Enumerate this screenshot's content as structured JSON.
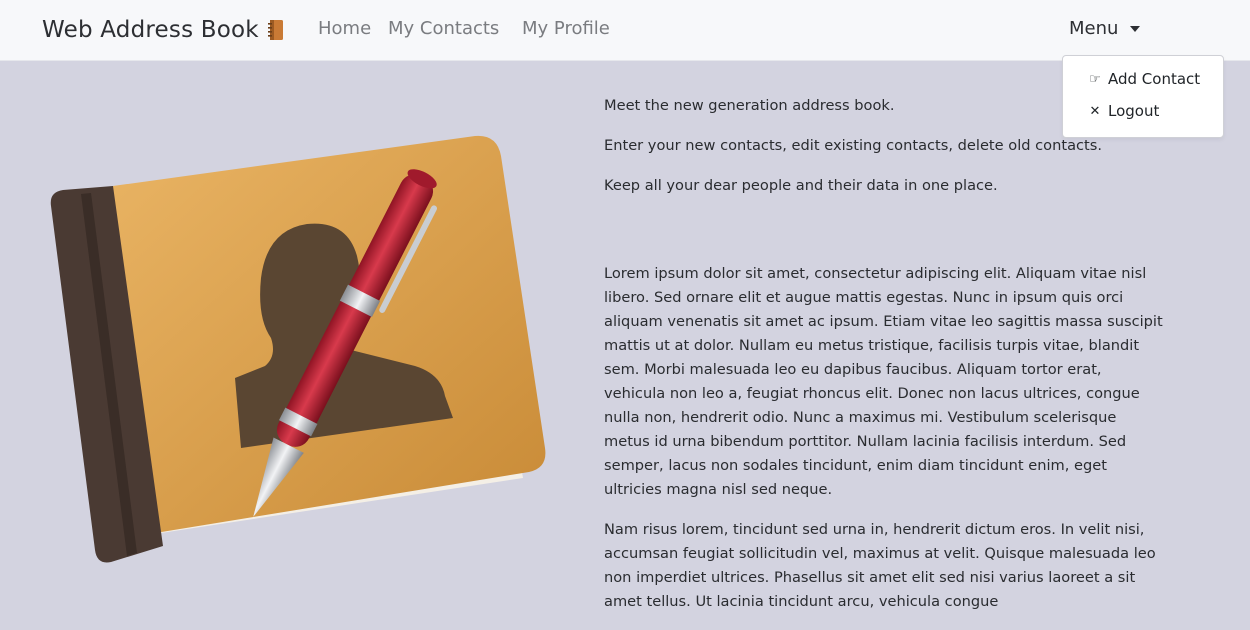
{
  "navbar": {
    "brand": "Web Address Book",
    "brand_icon": "notebook-icon",
    "links": [
      "Home",
      "My Contacts",
      "My Profile"
    ],
    "menu_label": "Menu"
  },
  "dropdown": {
    "items": [
      {
        "label": "Add Contact",
        "icon": "pointing-hand-icon"
      },
      {
        "label": "Logout",
        "icon": "close-icon"
      }
    ]
  },
  "intro": [
    "Meet the new generation address book.",
    "Enter your new contacts, edit existing contacts, delete old contacts.",
    "Keep all your dear people and their data in one place."
  ],
  "body": [
    "Lorem ipsum dolor sit amet, consectetur adipiscing elit. Aliquam vitae nisl libero. Sed ornare elit et augue mattis egestas. Nunc in ipsum quis orci aliquam venenatis sit amet ac ipsum. Etiam vitae leo sagittis massa suscipit mattis ut at dolor. Nullam eu metus tristique, facilisis turpis vitae, blandit sem. Morbi malesuada leo eu dapibus faucibus. Aliquam tortor erat, vehicula non leo a, feugiat rhoncus elit. Donec non lacus ultrices, congue nulla non, hendrerit odio. Nunc a maximus mi. Vestibulum scelerisque metus id urna bibendum porttitor. Nullam lacinia facilisis interdum. Sed semper, lacus non sodales tincidunt, enim diam tincidunt enim, eget ultricies magna nisl sed neque.",
    "Nam risus lorem, tincidunt sed urna in, hendrerit dictum eros. In velit nisi, accumsan feugiat sollicitudin vel, maximus at velit. Quisque malesuada leo non imperdiet ultrices. Phasellus sit amet elit sed nisi varius laoreet a sit amet tellus. Ut lacinia tincidunt arcu, vehicula congue"
  ],
  "colors": {
    "background": "#d3d3e0",
    "navbar": "#f7f8fa",
    "book_cover": "#d9a24a",
    "book_spine": "#4a3a33",
    "pen_red": "#c8273a"
  }
}
